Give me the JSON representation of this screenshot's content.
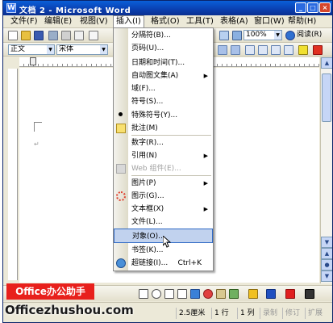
{
  "window": {
    "title": "文档 2 - Microsoft Word",
    "app_icon_letter": "W",
    "minimize": "_",
    "maximize": "□",
    "close": "×"
  },
  "menubar": {
    "items": [
      "文件(F)",
      "编辑(E)",
      "视图(V)",
      "插入(I)",
      "格式(O)",
      "工具(T)",
      "表格(A)",
      "窗口(W)",
      "帮助(H)"
    ],
    "active": "插入(I)"
  },
  "toolbar": {
    "zoom": "100%",
    "read_label": "阅读(R)",
    "style": "正文",
    "font": "宋体"
  },
  "insert_menu": {
    "items": [
      {
        "label": "分隔符(B)...",
        "key": "B",
        "submenu": false,
        "disabled": false
      },
      {
        "label": "页码(U)...",
        "key": "U",
        "submenu": false,
        "disabled": false
      },
      {
        "label": "日期和时间(T)...",
        "key": "T",
        "submenu": false,
        "disabled": false
      },
      {
        "label": "自动图文集(A)",
        "key": "A",
        "submenu": true,
        "disabled": false
      },
      {
        "label": "域(F)...",
        "key": "F",
        "submenu": false,
        "disabled": false
      },
      {
        "label": "符号(S)...",
        "key": "S",
        "submenu": false,
        "disabled": false
      },
      {
        "label": "特殊符号(Y)...",
        "key": "Y",
        "submenu": false,
        "disabled": false
      },
      {
        "label": "批注(M)",
        "key": "M",
        "submenu": false,
        "disabled": false
      },
      {
        "label": "数字(R)...",
        "key": "R",
        "submenu": false,
        "disabled": false
      },
      {
        "label": "引用(N)",
        "key": "N",
        "submenu": true,
        "disabled": false
      },
      {
        "label": "Web 组件(E)...",
        "key": "E",
        "submenu": false,
        "disabled": true
      },
      {
        "label": "图片(P)",
        "key": "P",
        "submenu": true,
        "disabled": false
      },
      {
        "label": "图示(G)...",
        "key": "G",
        "submenu": false,
        "disabled": false
      },
      {
        "label": "文本框(X)",
        "key": "X",
        "submenu": true,
        "disabled": false
      },
      {
        "label": "文件(L)...",
        "key": "L",
        "submenu": false,
        "disabled": false
      },
      {
        "label": "对象(O)...",
        "key": "O",
        "submenu": false,
        "disabled": false,
        "highlighted": true
      },
      {
        "label": "书签(K)...",
        "key": "K",
        "submenu": false,
        "disabled": false
      },
      {
        "label": "超链接(I)...",
        "key": "I",
        "submenu": false,
        "disabled": false,
        "shortcut": "Ctrl+K"
      }
    ]
  },
  "statusbar": {
    "position": "2.5厘米",
    "line": "1 行",
    "column": "1 列",
    "rec": "录制",
    "trk": "修订",
    "ext": "扩展"
  },
  "watermark": {
    "badge": "Office办公助手",
    "site": "Officezhushou.com"
  },
  "colors": {
    "titlebar": "#0a3fb0",
    "menu_highlight": "#c1d2ee",
    "watermark_red": "#e8201c"
  }
}
